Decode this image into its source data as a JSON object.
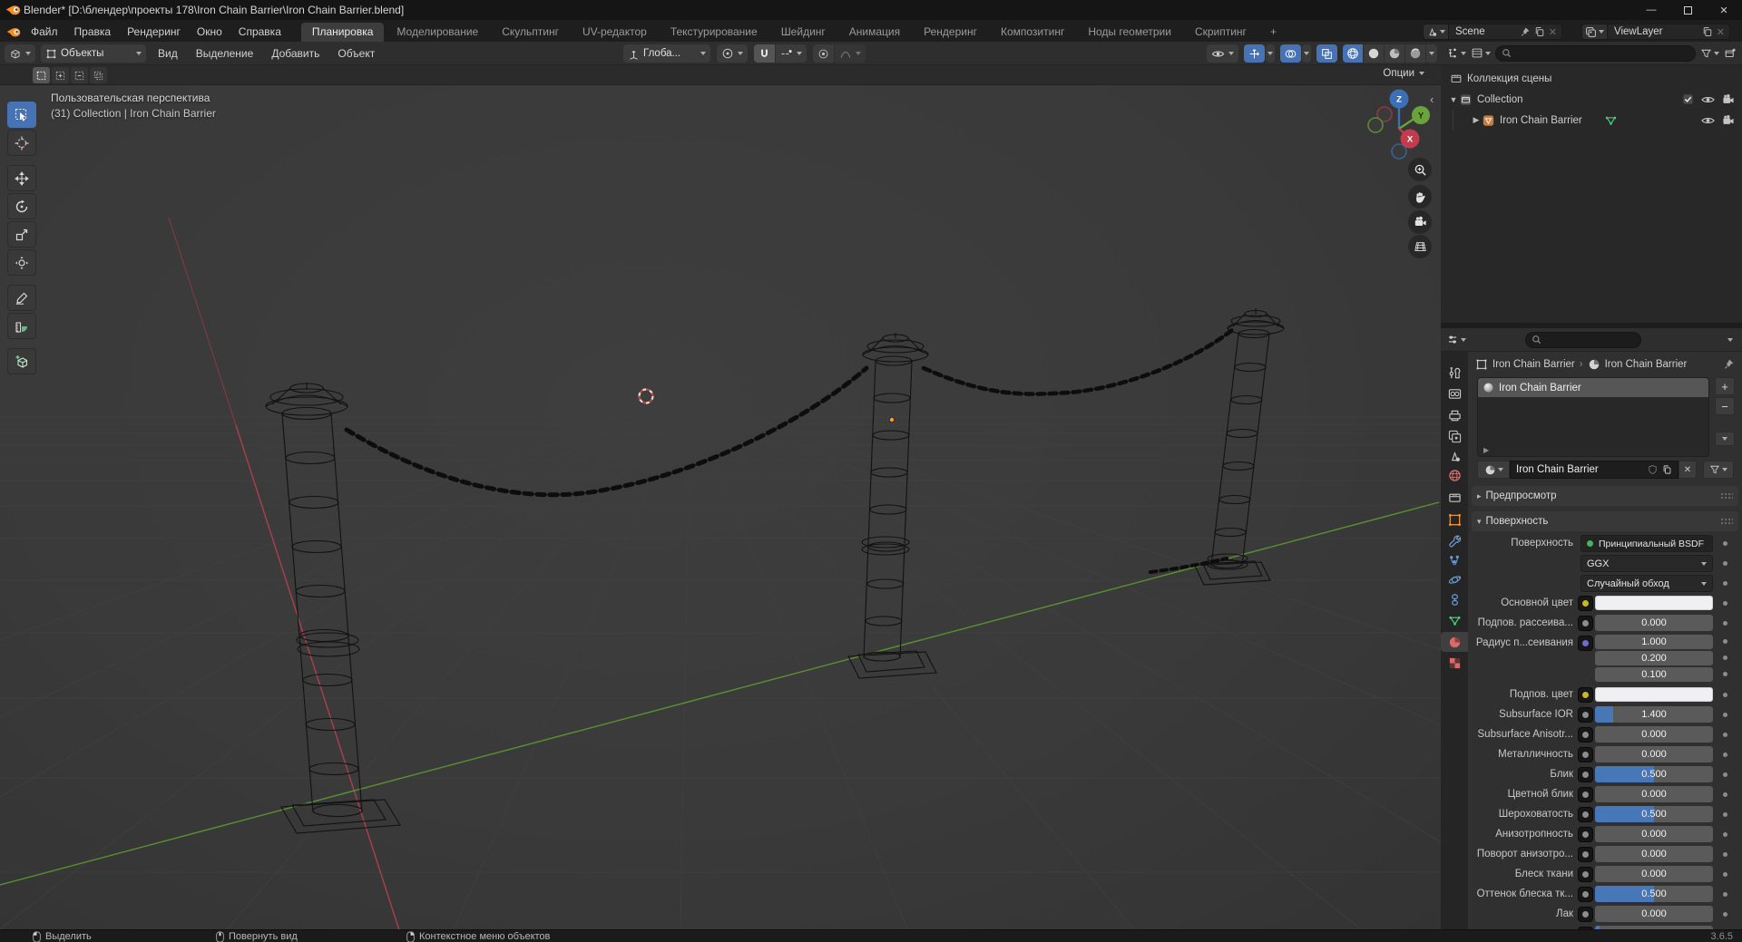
{
  "window": {
    "title": "Blender* [D:\\блендер\\проекты 178\\Iron Chain Barrier\\Iron Chain Barrier.blend]"
  },
  "topbar": {
    "menus": [
      "Файл",
      "Правка",
      "Рендеринг",
      "Окно",
      "Справка"
    ],
    "tabs": [
      "Планировка",
      "Моделирование",
      "Скульптинг",
      "UV-редактор",
      "Текстурирование",
      "Шейдинг",
      "Анимация",
      "Рендеринг",
      "Композитинг",
      "Ноды геометрии",
      "Скриптинг"
    ],
    "active_tab": "Планировка",
    "add_tab": "+",
    "scene": "Scene",
    "view_layer": "ViewLayer"
  },
  "viewport": {
    "mode": "Объекты",
    "menus": [
      "Вид",
      "Выделение",
      "Добавить",
      "Объект"
    ],
    "orientation": "Глоба...",
    "options": "Опции",
    "overlay_line1": "Пользовательская перспектива",
    "overlay_line2": "(31) Collection | Iron Chain Barrier",
    "gizmo": {
      "x": "X",
      "y": "Y",
      "z": "Z"
    }
  },
  "outliner": {
    "scene_collection": "Коллекция сцены",
    "collection": "Collection",
    "object": "Iron Chain Barrier"
  },
  "properties": {
    "breadcrumb_object": "Iron Chain Barrier",
    "breadcrumb_material": "Iron Chain Barrier",
    "slot_material": "Iron Chain Barrier",
    "slot_add": "+",
    "slot_remove": "−",
    "material_name": "Iron Chain Barrier",
    "panel_preview": "Предпросмотр",
    "panel_surface": "Поверхность",
    "surface_label": "Поверхность",
    "surface_shader": "Принципиальный BSDF",
    "distribution": "GGX",
    "sss_method": "Случайный обход",
    "rows": [
      {
        "label": "Основной цвет"
      },
      {
        "label": "Подпов. рассеива...",
        "value": "0.000"
      },
      {
        "label": "Радиус п...сеивания",
        "v1": "1.000",
        "v2": "0.200",
        "v3": "0.100"
      },
      {
        "label": "Подпов. цвет"
      },
      {
        "label": "Subsurface IOR",
        "value": "1.400"
      },
      {
        "label": "Subsurface Anisotr...",
        "value": "0.000"
      },
      {
        "label": "Металличность",
        "value": "0.000"
      },
      {
        "label": "Блик",
        "value": "0.500"
      },
      {
        "label": "Цветной блик",
        "value": "0.000"
      },
      {
        "label": "Шероховатость",
        "value": "0.500"
      },
      {
        "label": "Анизотропность",
        "value": "0.000"
      },
      {
        "label": "Поворот анизотро...",
        "value": "0.000"
      },
      {
        "label": "Блеск ткани",
        "value": "0.000"
      },
      {
        "label": "Оттенок блеска тк...",
        "value": "0.500"
      },
      {
        "label": "Лак",
        "value": "0.000"
      }
    ]
  },
  "status": {
    "hint_left": "Выделить",
    "hint_middle": "Повернуть вид",
    "hint_right": "Контекстное меню объектов",
    "version": "3.6.5"
  },
  "colors": {
    "accent_blue": "#4772b3",
    "object_orange": "#e8913c",
    "axis_red": "#b2404f",
    "axis_green": "#5d9c31",
    "mesh_green": "#54c27a",
    "material_red": "#d96a6a"
  }
}
